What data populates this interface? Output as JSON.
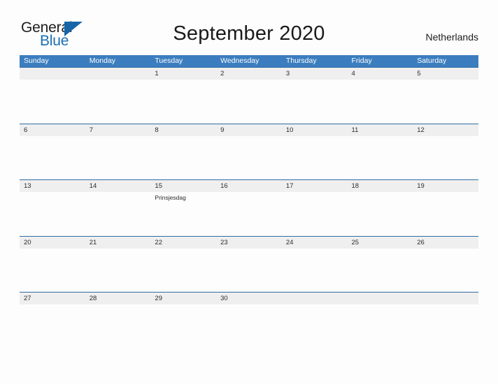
{
  "brand": {
    "word_one": "General",
    "word_two": "Blue",
    "triangle_icon": "triangle-icon",
    "dark_color": "#1C1C1C",
    "blue_color": "#1A6FB5",
    "triangle_color": "#1565A8"
  },
  "header": {
    "title": "September 2020",
    "country": "Netherlands"
  },
  "colors": {
    "weekday_header_bg": "#3B7DBF",
    "weekday_header_text": "#FFFFFF",
    "date_band_bg": "#EFEFEF",
    "row_divider": "#2E6DA4",
    "page_bg": "#FDFDFD",
    "text": "#2B2B2B"
  },
  "calendar": {
    "weekdays": [
      "Sunday",
      "Monday",
      "Tuesday",
      "Wednesday",
      "Thursday",
      "Friday",
      "Saturday"
    ],
    "weeks": [
      [
        {
          "day": "",
          "event": ""
        },
        {
          "day": "",
          "event": ""
        },
        {
          "day": "1",
          "event": ""
        },
        {
          "day": "2",
          "event": ""
        },
        {
          "day": "3",
          "event": ""
        },
        {
          "day": "4",
          "event": ""
        },
        {
          "day": "5",
          "event": ""
        }
      ],
      [
        {
          "day": "6",
          "event": ""
        },
        {
          "day": "7",
          "event": ""
        },
        {
          "day": "8",
          "event": ""
        },
        {
          "day": "9",
          "event": ""
        },
        {
          "day": "10",
          "event": ""
        },
        {
          "day": "11",
          "event": ""
        },
        {
          "day": "12",
          "event": ""
        }
      ],
      [
        {
          "day": "13",
          "event": ""
        },
        {
          "day": "14",
          "event": ""
        },
        {
          "day": "15",
          "event": "Prinsjesdag"
        },
        {
          "day": "16",
          "event": ""
        },
        {
          "day": "17",
          "event": ""
        },
        {
          "day": "18",
          "event": ""
        },
        {
          "day": "19",
          "event": ""
        }
      ],
      [
        {
          "day": "20",
          "event": ""
        },
        {
          "day": "21",
          "event": ""
        },
        {
          "day": "22",
          "event": ""
        },
        {
          "day": "23",
          "event": ""
        },
        {
          "day": "24",
          "event": ""
        },
        {
          "day": "25",
          "event": ""
        },
        {
          "day": "26",
          "event": ""
        }
      ],
      [
        {
          "day": "27",
          "event": ""
        },
        {
          "day": "28",
          "event": ""
        },
        {
          "day": "29",
          "event": ""
        },
        {
          "day": "30",
          "event": ""
        },
        {
          "day": "",
          "event": ""
        },
        {
          "day": "",
          "event": ""
        },
        {
          "day": "",
          "event": ""
        }
      ]
    ]
  }
}
